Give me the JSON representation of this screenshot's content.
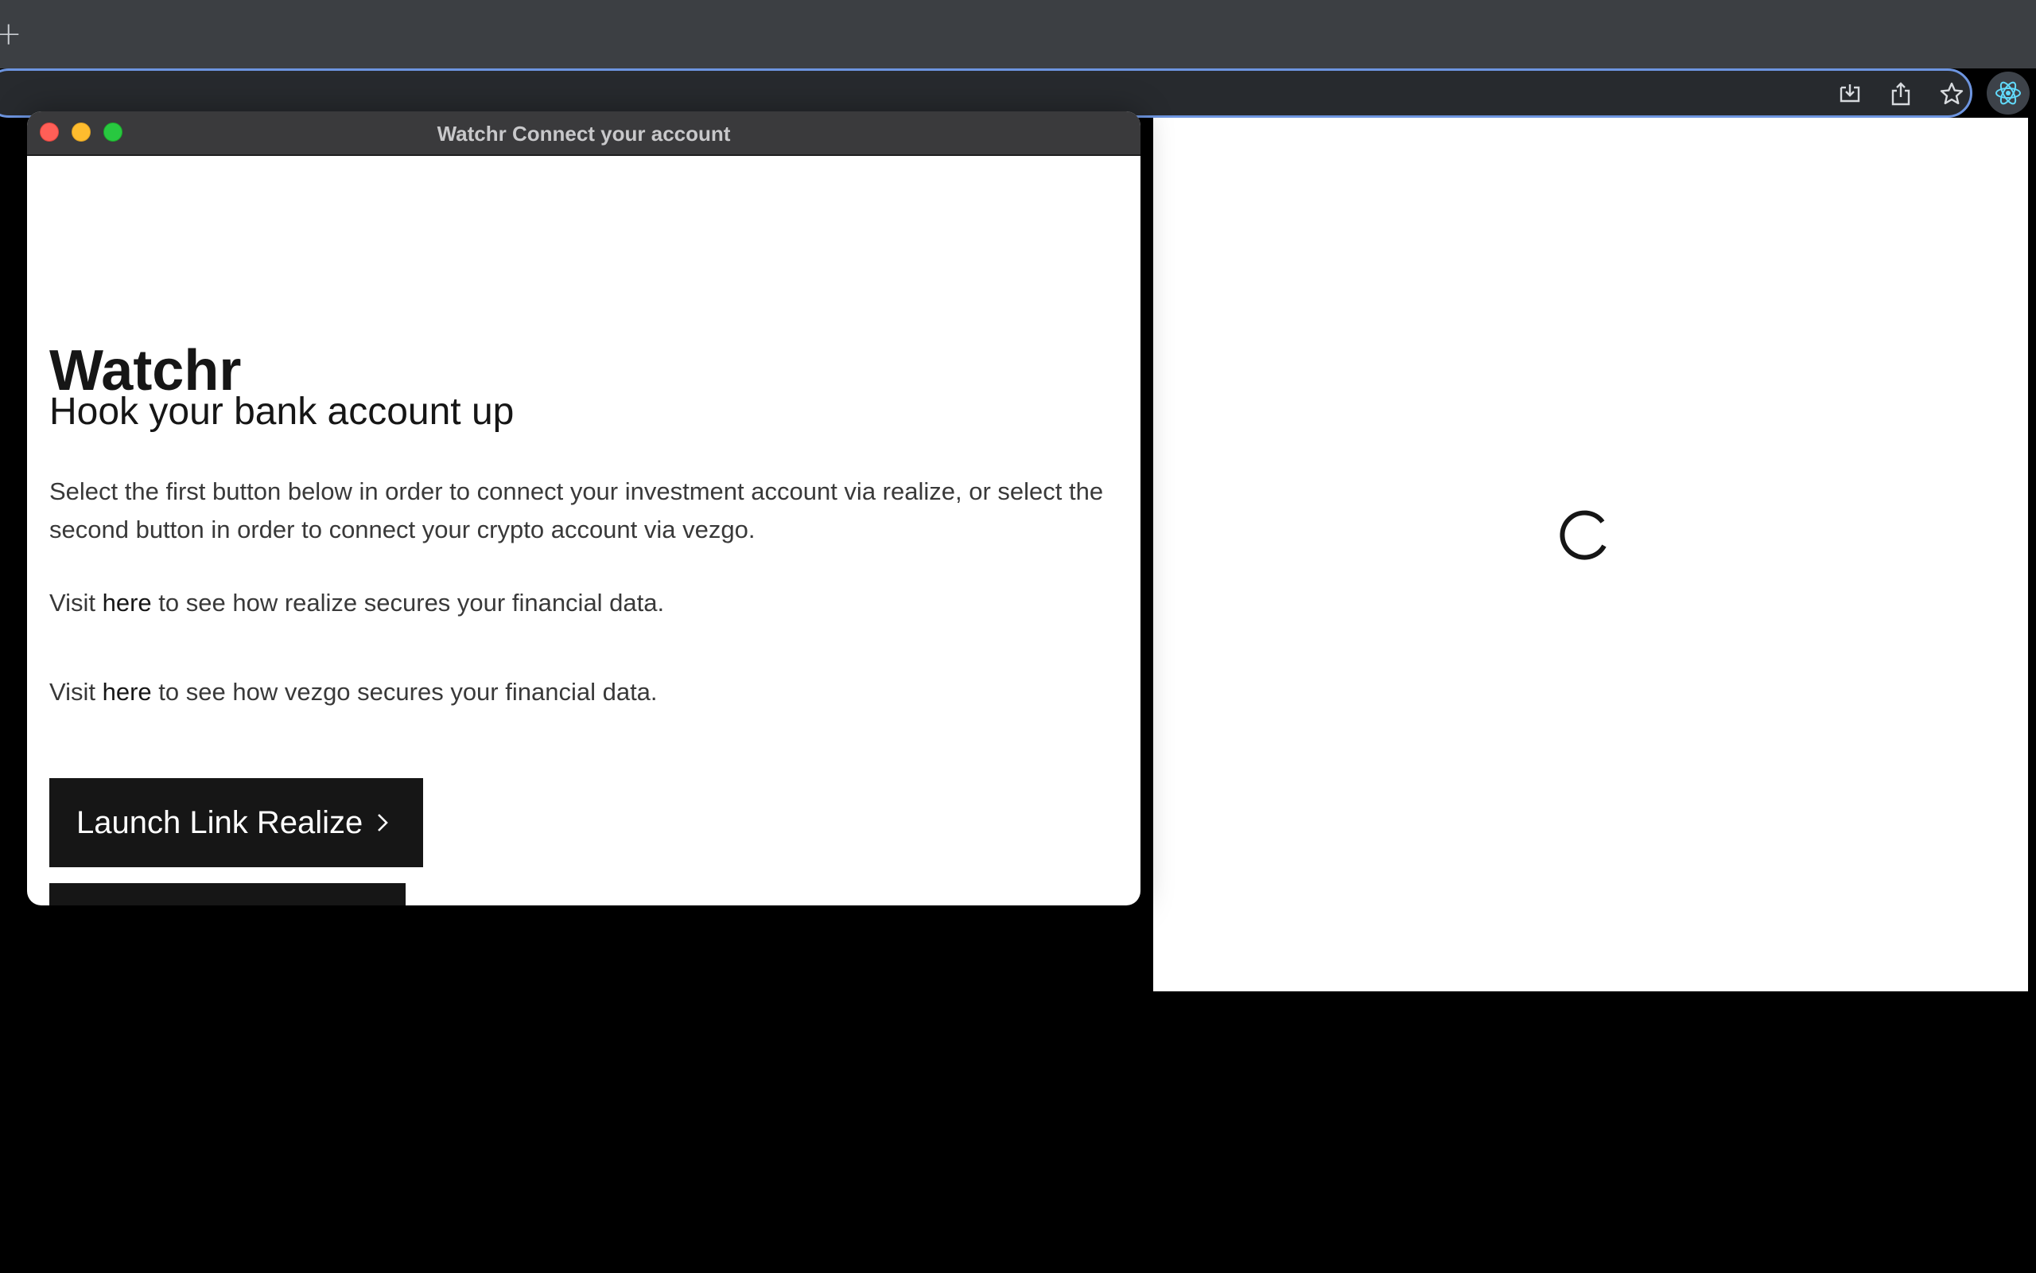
{
  "browser": {
    "new_tab_symbol": "+",
    "toolbar_icons": [
      "download-icon",
      "share-icon",
      "bookmark-star-icon"
    ],
    "extension_icon": "react-icon",
    "accent_color": "#6d95e0"
  },
  "popup": {
    "window_title": "Watchr Connect your account",
    "heading": "Watchr",
    "subtitle": "Hook your bank account up",
    "intro": "Select the first button below in order to connect your investment account via realize, or select the second button in order to connect your crypto account via vezgo.",
    "realize_note": {
      "prefix": "Visit ",
      "link": "here",
      "suffix": " to see how realize secures your financial data."
    },
    "vezgo_note": {
      "prefix": "Visit ",
      "link": "here",
      "suffix": " to see how vezgo secures your financial data."
    },
    "launch_realize_label": "Launch Link Realize"
  },
  "page": {
    "state": "loading"
  }
}
